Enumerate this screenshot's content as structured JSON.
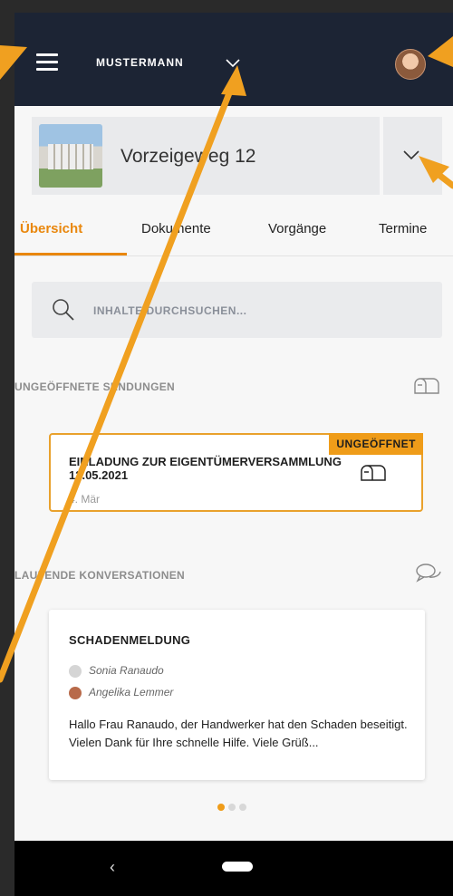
{
  "appbar": {
    "brand": "MUSTERMANN"
  },
  "property": {
    "name": "Vorzeigeweg 12"
  },
  "tabs": [
    "Übersicht",
    "Dokumente",
    "Vorgänge",
    "Termine"
  ],
  "search": {
    "placeholder": "INHALTE DURCHSUCHEN..."
  },
  "sections": {
    "unopened": "UNGEÖFFNETE SENDUNGEN",
    "conversations": "LAUFENDE KONVERSATIONEN"
  },
  "mail_card": {
    "badge": "UNGEÖFFNET",
    "title": "EINLADUNG ZUR EIGENTÜMERVERSAMMLUNG 12.05.2021",
    "date": "4. Mär"
  },
  "conversation": {
    "title": "SCHADENMELDUNG",
    "participants": [
      "Sonia Ranaudo",
      "Angelika Lemmer"
    ],
    "message": "Hallo Frau Ranaudo, der Handwerker hat den Schaden beseitigt. Vielen Dank für Ihre schnelle Hilfe. Viele Grüß..."
  },
  "navbar": {
    "back": "‹"
  },
  "colors": {
    "accent": "#ef9c19",
    "appbar": "#1c2434",
    "arrow": "#f0a020"
  }
}
